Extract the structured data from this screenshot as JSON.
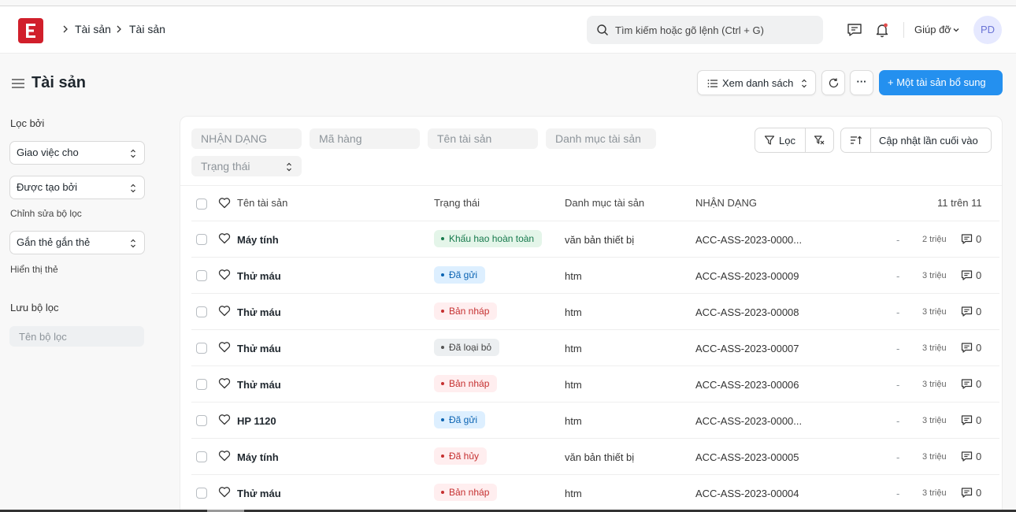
{
  "breadcrumb": [
    "Tài sản",
    "Tài sản"
  ],
  "search": {
    "placeholder": "Tìm kiếm hoặc gõ lệnh (Ctrl + G)"
  },
  "help_label": "Giúp đỡ",
  "avatar_initials": "PD",
  "page_title": "Tài sản",
  "toolbar": {
    "view_label": "Xem danh sách",
    "more_label": "···",
    "add_label": "+ Một tài sản bổ sung"
  },
  "sidebar": {
    "filter_by": "Lọc bởi",
    "assigned_to": "Giao việc cho",
    "created_by": "Được tạo bởi",
    "edit_filters": "Chỉnh sửa bộ lọc",
    "tags": "Gắn thẻ gắn thẻ",
    "show_tags": "Hiển thị thẻ",
    "save_filter": "Lưu bộ lọc",
    "filter_name_placeholder": "Tên bộ lọc"
  },
  "filters": {
    "id": "NHẬN DẠNG",
    "item_code": "Mã hàng",
    "asset_name": "Tên tài sản",
    "asset_category": "Danh mục tài sản",
    "status": "Trạng thái",
    "filter_btn": "Lọc",
    "sort_label": "Cập nhật lần cuối vào"
  },
  "table": {
    "columns": [
      "Tên tài sản",
      "Trạng thái",
      "Danh mục tài sản",
      "NHẬN DẠNG"
    ],
    "count": "11 trên 11",
    "rows": [
      {
        "name": "Máy tính",
        "status": "Khấu hao hoàn toàn",
        "category": "văn bản thiết bị",
        "id": "ACC-ASS-2023-0000...",
        "dash": "-",
        "time": "2 triệu",
        "comments": "0"
      },
      {
        "name": "Thử máu",
        "status": "Đã gửi",
        "category": "htm",
        "id": "ACC-ASS-2023-00009",
        "dash": "-",
        "time": "3 triệu",
        "comments": "0"
      },
      {
        "name": "Thử máu",
        "status": "Bản nháp",
        "category": "htm",
        "id": "ACC-ASS-2023-00008",
        "dash": "-",
        "time": "3 triệu",
        "comments": "0"
      },
      {
        "name": "Thử máu",
        "status": "Đã loại bỏ",
        "category": "htm",
        "id": "ACC-ASS-2023-00007",
        "dash": "-",
        "time": "3 triệu",
        "comments": "0"
      },
      {
        "name": "Thử máu",
        "status": "Bản nháp",
        "category": "htm",
        "id": "ACC-ASS-2023-00006",
        "dash": "-",
        "time": "3 triệu",
        "comments": "0"
      },
      {
        "name": "HP 1120",
        "status": "Đã gửi",
        "category": "htm",
        "id": "ACC-ASS-2023-0000...",
        "dash": "-",
        "time": "3 triệu",
        "comments": "0"
      },
      {
        "name": "Máy tính",
        "status": "Đã hủy",
        "category": "văn bản thiết bị",
        "id": "ACC-ASS-2023-00005",
        "dash": "-",
        "time": "3 triệu",
        "comments": "0"
      },
      {
        "name": "Thử máu",
        "status": "Bản nháp",
        "category": "htm",
        "id": "ACC-ASS-2023-00004",
        "dash": "-",
        "time": "3 triệu",
        "comments": "0"
      }
    ]
  },
  "colors": {
    "primary": "#2490ef",
    "logo": "#d11f2b"
  }
}
